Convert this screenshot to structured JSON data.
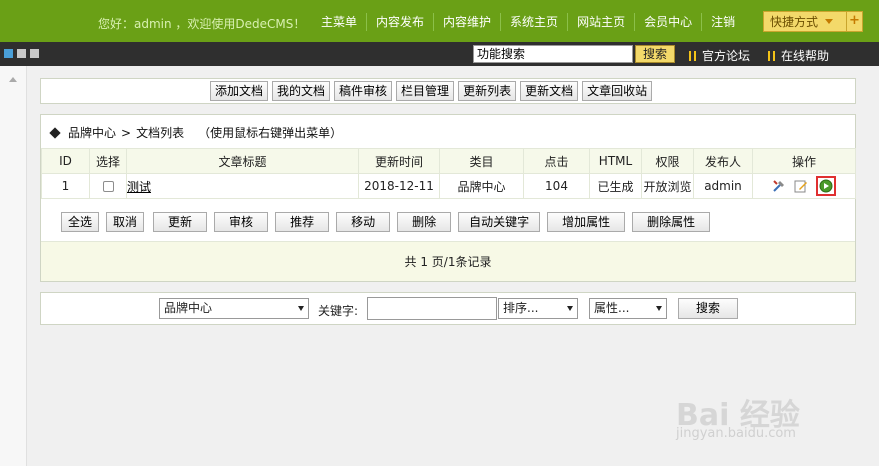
{
  "header": {
    "greeting": "您好：admin ，欢迎使用DedeCMS！",
    "nav": [
      "主菜单",
      "内容发布",
      "内容维护",
      "系统主页",
      "网站主页",
      "会员中心",
      "注销"
    ],
    "quick_label": "快捷方式",
    "quick_plus": "+"
  },
  "subbar": {
    "search_value": "功能搜索",
    "search_button": "搜索",
    "links": [
      "官方论坛",
      "在线帮助"
    ]
  },
  "toolbar": {
    "buttons": [
      "添加文档",
      "我的文档",
      "稿件审核",
      "栏目管理",
      "更新列表",
      "更新文档",
      "文章回收站"
    ]
  },
  "list": {
    "breadcrumb": [
      "品牌中心",
      ">",
      "文档列表"
    ],
    "hint": "（使用鼠标右键弹出菜单）",
    "columns": [
      "ID",
      "选择",
      "文章标题",
      "更新时间",
      "类目",
      "点击",
      "HTML",
      "权限",
      "发布人",
      "操作"
    ],
    "rows": [
      {
        "id": "1",
        "title": "测试",
        "updated": "2018-12-11",
        "category": "品牌中心",
        "clicks": "104",
        "html": "已生成",
        "permission": "开放浏览",
        "publisher": "admin"
      }
    ],
    "actions": [
      "全选",
      "取消",
      "更新",
      "审核",
      "推荐",
      "移动",
      "删除",
      "自动关键字",
      "增加属性",
      "删除属性"
    ],
    "pager": "共 1 页/1条记录"
  },
  "search": {
    "category": "品牌中心",
    "keyword_label": "关键字:",
    "keyword_value": "",
    "sort": "排序...",
    "attr": "属性...",
    "button": "搜索"
  },
  "watermark": {
    "brand": "Bai 经验",
    "url": "jingyan.baidu.com"
  },
  "colors": {
    "header_green": "#6aa016",
    "dark_bar": "#2f2f2f",
    "quick_yellow": "#f3d96a",
    "highlight_red": "#e03030"
  }
}
